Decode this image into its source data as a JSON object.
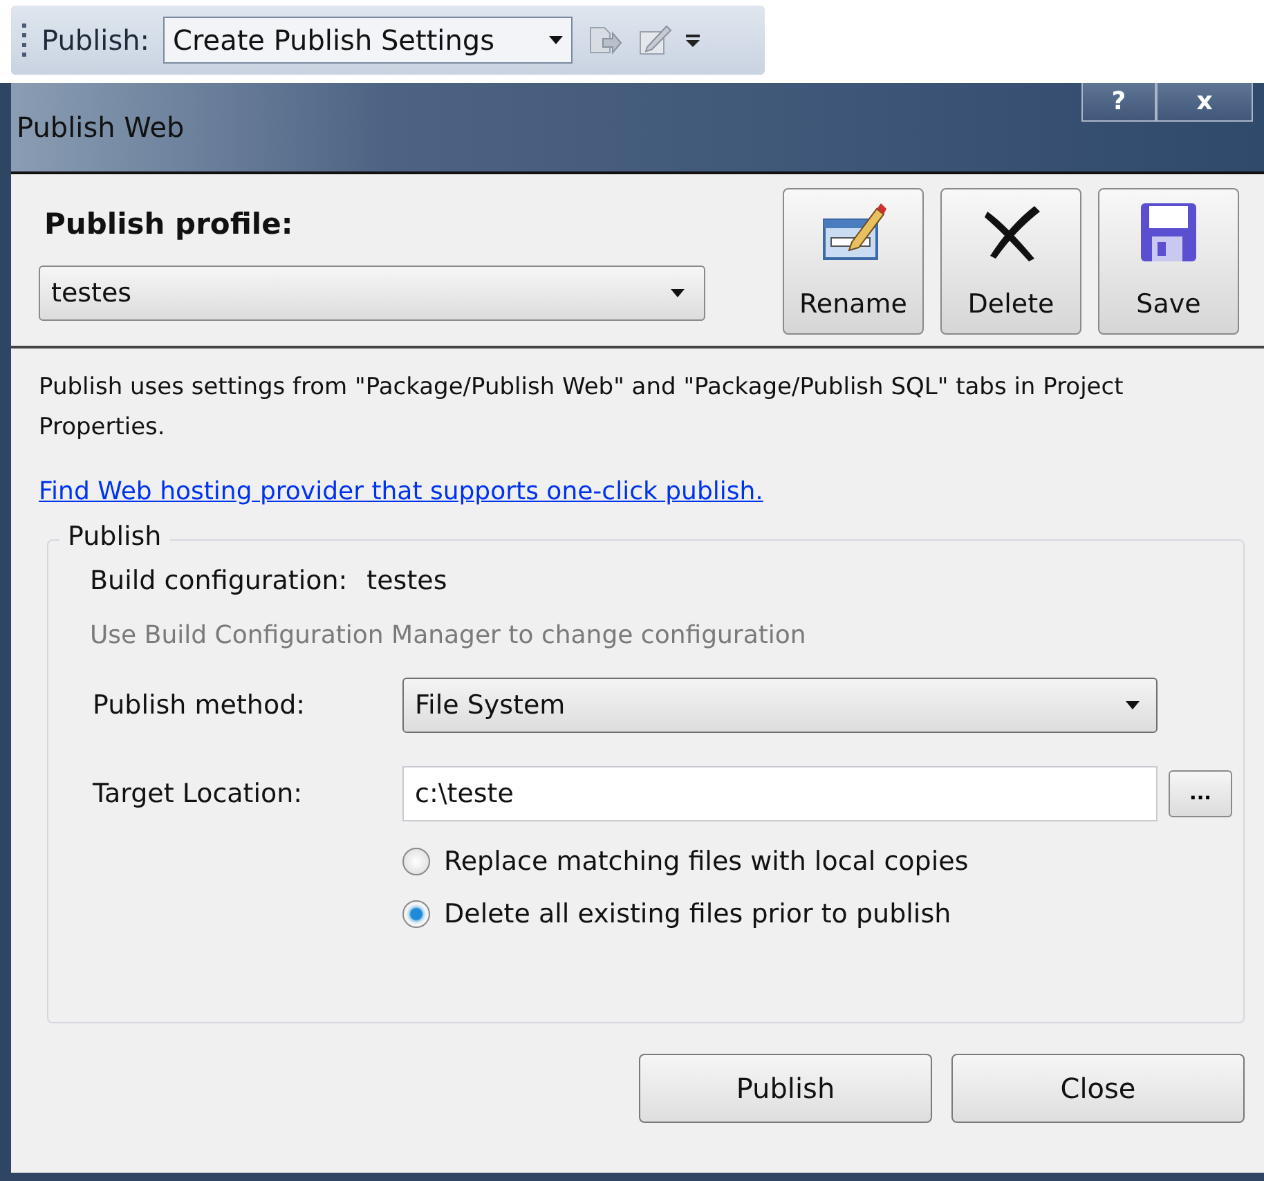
{
  "toolbar": {
    "label": "Publish:",
    "combo_value": "Create Publish Settings"
  },
  "window": {
    "title": "Publish Web",
    "title_buttons": [
      "?",
      "x"
    ]
  },
  "profile": {
    "label": "Publish profile:",
    "value": "testes"
  },
  "profile_buttons": [
    {
      "kind": "rename",
      "label": "Rename"
    },
    {
      "kind": "delete",
      "label": "Delete"
    },
    {
      "kind": "save",
      "label": "Save"
    }
  ],
  "description": "Publish uses settings from \"Package/Publish Web\" and \"Package/Publish SQL\" tabs in Project Properties.",
  "link": "Find Web hosting provider that supports one-click publish.",
  "group": {
    "title": "Publish",
    "build_label": "Build configuration:",
    "build_value": "testes",
    "hint": "Use Build Configuration Manager to change configuration",
    "method_label": "Publish method:",
    "method_value": "File System",
    "location_label": "Target Location:",
    "location_value": "c:\\teste",
    "browse_label": "...",
    "options": [
      {
        "label": "Replace matching files with local copies",
        "selected": false
      },
      {
        "label": "Delete all existing files prior to publish",
        "selected": true
      }
    ]
  },
  "buttons": [
    {
      "label": "Publish"
    },
    {
      "label": "Close"
    }
  ]
}
